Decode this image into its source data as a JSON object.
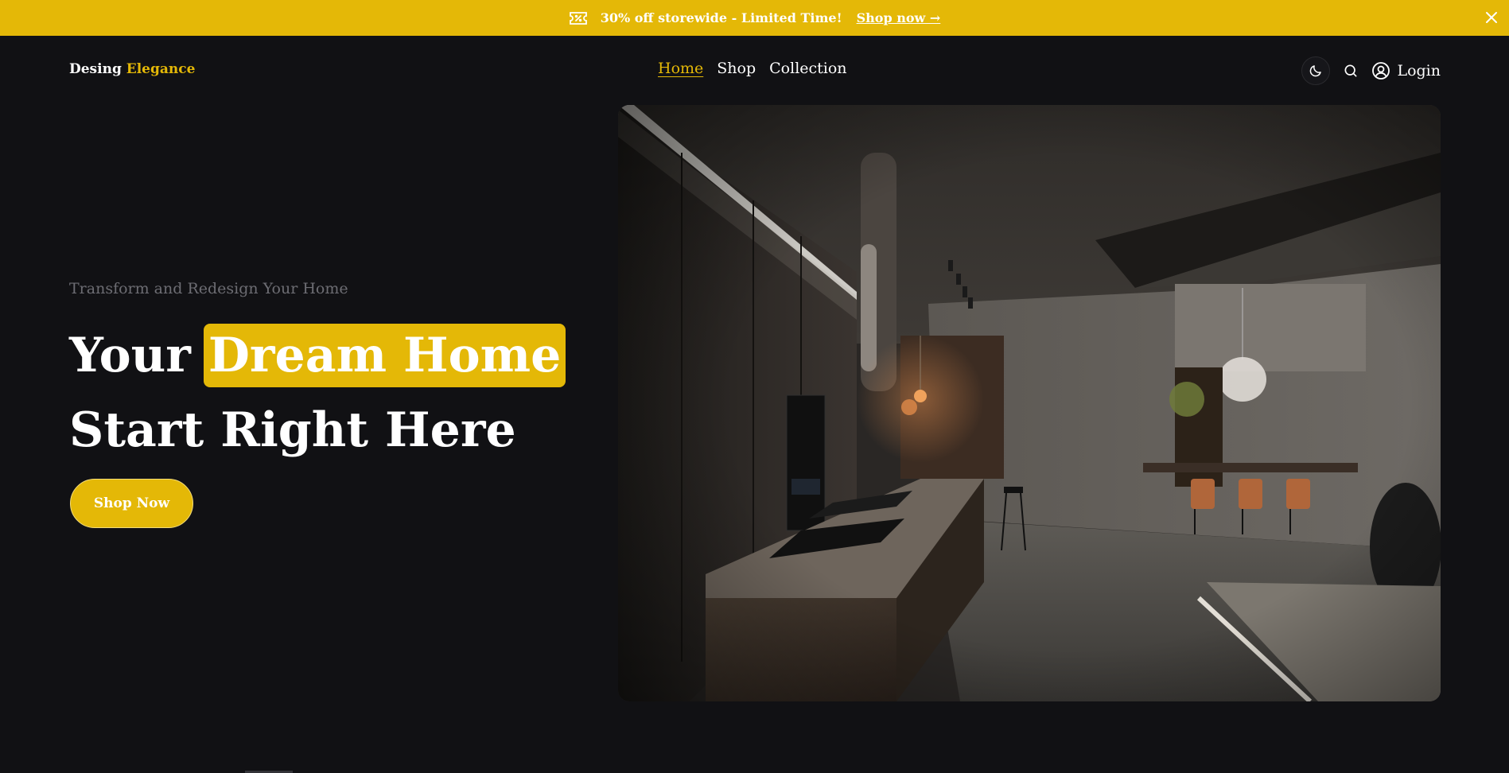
{
  "announcement": {
    "icon": "ticket-icon",
    "message": "30% off storewide - Limited Time!",
    "link_label": "Shop now →",
    "close_icon": "close-icon"
  },
  "header": {
    "logo_primary": "Desing",
    "logo_accent": "Elegance",
    "nav": [
      {
        "label": "Home",
        "active": true
      },
      {
        "label": "Shop",
        "active": false
      },
      {
        "label": "Collection",
        "active": false
      }
    ],
    "theme_toggle_icon": "moon-icon",
    "search_icon": "search-icon",
    "login_icon": "user-circle-icon",
    "login_label": "Login"
  },
  "hero": {
    "eyebrow": "Transform and Redesign Your Home",
    "headline_plain": "Your",
    "headline_highlight": "Dream Home",
    "headline_line2": "Start Right Here",
    "cta_label": "Shop Now",
    "image_alt": "modern-dark-kitchen-interior"
  },
  "colors": {
    "accent": "#e4b807",
    "background": "#111114",
    "muted_text": "#6d6d73"
  }
}
